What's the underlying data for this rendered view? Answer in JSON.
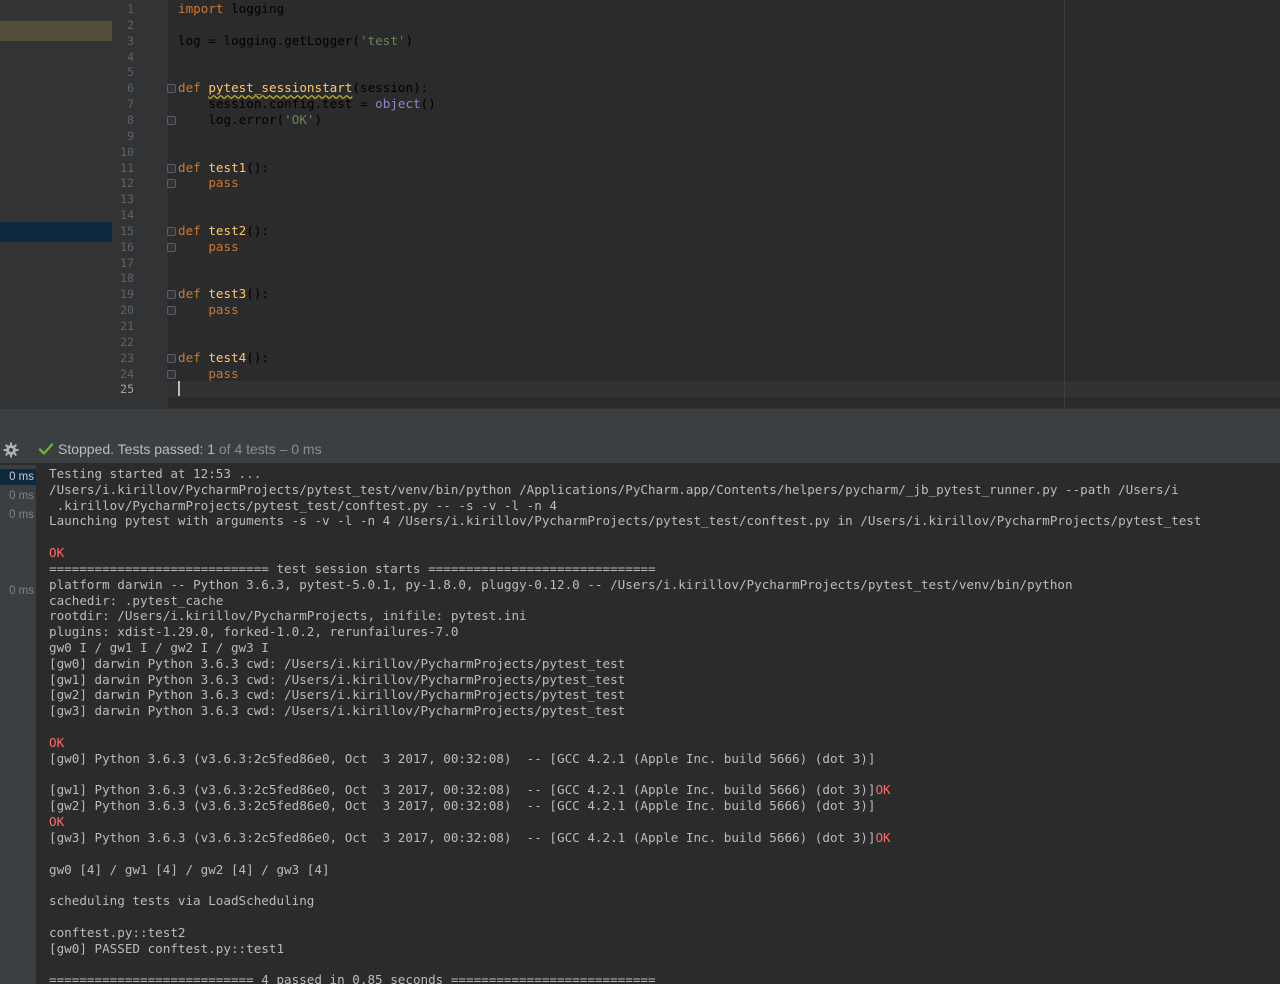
{
  "editor": {
    "lines": [
      {
        "n": "1",
        "tokens": [
          {
            "t": "import",
            "c": "kw"
          },
          {
            "t": " logging",
            "c": ""
          }
        ]
      },
      {
        "n": "2",
        "tokens": []
      },
      {
        "n": "3",
        "tokens": [
          {
            "t": "log = logging.getLogger(",
            "c": ""
          },
          {
            "t": "'test'",
            "c": "str"
          },
          {
            "t": ")",
            "c": ""
          }
        ]
      },
      {
        "n": "4",
        "tokens": []
      },
      {
        "n": "5",
        "tokens": []
      },
      {
        "n": "6",
        "fold": true,
        "tokens": [
          {
            "t": "def ",
            "c": "kw"
          },
          {
            "t": "pytest_sessionstart",
            "c": "fn-warn"
          },
          {
            "t": "(session):",
            "c": ""
          }
        ]
      },
      {
        "n": "7",
        "tokens": [
          {
            "t": "    session.config.test = ",
            "c": ""
          },
          {
            "t": "object",
            "c": "builtin"
          },
          {
            "t": "()",
            "c": ""
          }
        ]
      },
      {
        "n": "8",
        "fold": true,
        "tokens": [
          {
            "t": "    log.error(",
            "c": ""
          },
          {
            "t": "'OK'",
            "c": "str"
          },
          {
            "t": ")",
            "c": ""
          }
        ]
      },
      {
        "n": "9",
        "tokens": []
      },
      {
        "n": "10",
        "tokens": []
      },
      {
        "n": "11",
        "fold": true,
        "tokens": [
          {
            "t": "def ",
            "c": "kw"
          },
          {
            "t": "test1",
            "c": "fn"
          },
          {
            "t": "():",
            "c": ""
          }
        ]
      },
      {
        "n": "12",
        "fold": true,
        "tokens": [
          {
            "t": "    ",
            "c": ""
          },
          {
            "t": "pass",
            "c": "kw"
          }
        ]
      },
      {
        "n": "13",
        "tokens": []
      },
      {
        "n": "14",
        "tokens": []
      },
      {
        "n": "15",
        "fold": true,
        "tokens": [
          {
            "t": "def ",
            "c": "kw"
          },
          {
            "t": "test2",
            "c": "fn"
          },
          {
            "t": "():",
            "c": ""
          }
        ]
      },
      {
        "n": "16",
        "fold": true,
        "tokens": [
          {
            "t": "    ",
            "c": ""
          },
          {
            "t": "pass",
            "c": "kw"
          }
        ]
      },
      {
        "n": "17",
        "tokens": []
      },
      {
        "n": "18",
        "tokens": []
      },
      {
        "n": "19",
        "fold": true,
        "tokens": [
          {
            "t": "def ",
            "c": "kw"
          },
          {
            "t": "test3",
            "c": "fn"
          },
          {
            "t": "():",
            "c": ""
          }
        ]
      },
      {
        "n": "20",
        "fold": true,
        "tokens": [
          {
            "t": "    ",
            "c": ""
          },
          {
            "t": "pass",
            "c": "kw"
          }
        ]
      },
      {
        "n": "21",
        "tokens": []
      },
      {
        "n": "22",
        "tokens": []
      },
      {
        "n": "23",
        "fold": true,
        "tokens": [
          {
            "t": "def ",
            "c": "kw"
          },
          {
            "t": "test4",
            "c": "fn"
          },
          {
            "t": "():",
            "c": ""
          }
        ]
      },
      {
        "n": "24",
        "fold": true,
        "tokens": [
          {
            "t": "    ",
            "c": ""
          },
          {
            "t": "pass",
            "c": "kw"
          }
        ]
      },
      {
        "n": "25",
        "current": true,
        "caret": true,
        "tokens": []
      }
    ]
  },
  "run": {
    "status_icon": "check-icon",
    "status_prefix": "Stopped. Tests passed: ",
    "status_passed": "1",
    "status_of": " of 4 tests",
    "status_time": " – 0 ms",
    "times": [
      {
        "label": "0 ms",
        "selected": true
      },
      {
        "label": "0 ms",
        "selected": false
      },
      {
        "label": "0 ms",
        "selected": false
      },
      {
        "label": "0 ms",
        "selected": false
      }
    ],
    "console": [
      {
        "segs": [
          {
            "t": "Testing started at 12:53 ..."
          }
        ]
      },
      {
        "segs": [
          {
            "t": "/Users/i.kirillov/PycharmProjects/pytest_test/venv/bin/python /Applications/PyCharm.app/Contents/helpers/pycharm/_jb_pytest_runner.py --path /Users/i"
          }
        ]
      },
      {
        "segs": [
          {
            "t": " .kirillov/PycharmProjects/pytest_test/conftest.py -- -s -v -l -n 4"
          }
        ]
      },
      {
        "segs": [
          {
            "t": "Launching pytest with arguments -s -v -l -n 4 /Users/i.kirillov/PycharmProjects/pytest_test/conftest.py in /Users/i.kirillov/PycharmProjects/pytest_test"
          }
        ]
      },
      {
        "segs": []
      },
      {
        "segs": [
          {
            "t": "OK",
            "err": true
          }
        ]
      },
      {
        "segs": [
          {
            "t": "============================= test session starts =============================="
          }
        ]
      },
      {
        "segs": [
          {
            "t": "platform darwin -- Python 3.6.3, pytest-5.0.1, py-1.8.0, pluggy-0.12.0 -- /Users/i.kirillov/PycharmProjects/pytest_test/venv/bin/python"
          }
        ]
      },
      {
        "segs": [
          {
            "t": "cachedir: .pytest_cache"
          }
        ]
      },
      {
        "segs": [
          {
            "t": "rootdir: /Users/i.kirillov/PycharmProjects, inifile: pytest.ini"
          }
        ]
      },
      {
        "segs": [
          {
            "t": "plugins: xdist-1.29.0, forked-1.0.2, rerunfailures-7.0"
          }
        ]
      },
      {
        "segs": [
          {
            "t": "gw0 I / gw1 I / gw2 I / gw3 I"
          }
        ]
      },
      {
        "segs": [
          {
            "t": "[gw0] darwin Python 3.6.3 cwd: /Users/i.kirillov/PycharmProjects/pytest_test"
          }
        ]
      },
      {
        "segs": [
          {
            "t": "[gw1] darwin Python 3.6.3 cwd: /Users/i.kirillov/PycharmProjects/pytest_test"
          }
        ]
      },
      {
        "segs": [
          {
            "t": "[gw2] darwin Python 3.6.3 cwd: /Users/i.kirillov/PycharmProjects/pytest_test"
          }
        ]
      },
      {
        "segs": [
          {
            "t": "[gw3] darwin Python 3.6.3 cwd: /Users/i.kirillov/PycharmProjects/pytest_test"
          }
        ]
      },
      {
        "segs": []
      },
      {
        "segs": [
          {
            "t": "OK",
            "err": true
          }
        ]
      },
      {
        "segs": [
          {
            "t": "[gw0] Python 3.6.3 (v3.6.3:2c5fed86e0, Oct  3 2017, 00:32:08)  -- [GCC 4.2.1 (Apple Inc. build 5666) (dot 3)]"
          }
        ]
      },
      {
        "segs": []
      },
      {
        "segs": [
          {
            "t": "[gw1] Python 3.6.3 (v3.6.3:2c5fed86e0, Oct  3 2017, 00:32:08)  -- [GCC 4.2.1 (Apple Inc. build 5666) (dot 3)]"
          },
          {
            "t": "OK",
            "err": true
          }
        ]
      },
      {
        "segs": [
          {
            "t": "[gw2] Python 3.6.3 (v3.6.3:2c5fed86e0, Oct  3 2017, 00:32:08)  -- [GCC 4.2.1 (Apple Inc. build 5666) (dot 3)]"
          }
        ]
      },
      {
        "segs": [
          {
            "t": "OK",
            "err": true
          }
        ]
      },
      {
        "segs": [
          {
            "t": "[gw3] Python 3.6.3 (v3.6.3:2c5fed86e0, Oct  3 2017, 00:32:08)  -- [GCC 4.2.1 (Apple Inc. build 5666) (dot 3)]"
          },
          {
            "t": "OK",
            "err": true
          }
        ]
      },
      {
        "segs": []
      },
      {
        "segs": [
          {
            "t": "gw0 [4] / gw1 [4] / gw2 [4] / gw3 [4]"
          }
        ]
      },
      {
        "segs": []
      },
      {
        "segs": [
          {
            "t": "scheduling tests via LoadScheduling"
          }
        ]
      },
      {
        "segs": []
      },
      {
        "segs": [
          {
            "t": "conftest.py::test2"
          }
        ]
      },
      {
        "segs": [
          {
            "t": "[gw0] PASSED conftest.py::test1"
          }
        ]
      },
      {
        "segs": []
      },
      {
        "segs": [
          {
            "t": "=========================== 4 passed in 0.85 seconds ==========================="
          }
        ]
      }
    ]
  },
  "colors": {
    "background": "#2b2b2b",
    "keyword": "#cc7832",
    "function": "#ffc66d",
    "string": "#6a8759",
    "builtin": "#8888c6",
    "error": "#ff6b68",
    "success": "#5fb832"
  }
}
